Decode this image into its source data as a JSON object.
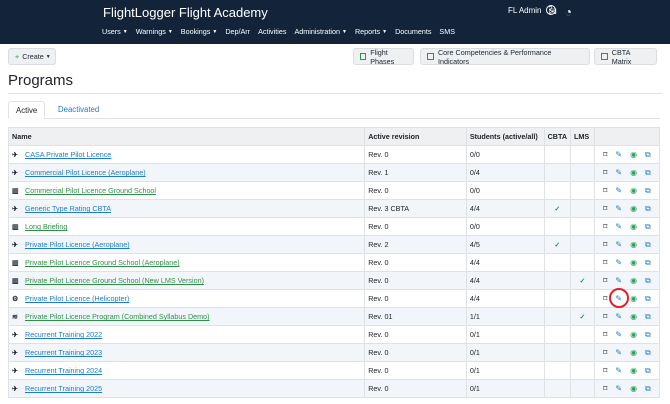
{
  "app": {
    "title": "FlightLogger Flight Academy",
    "user": "FL Admin",
    "help": "?"
  },
  "nav": [
    "Users",
    "Warnings",
    "Bookings",
    "Dep/Arr",
    "Activities",
    "Administration",
    "Reports",
    "Documents",
    "SMS"
  ],
  "toolbar": {
    "create": "Create",
    "flight_phases": "Flight Phases",
    "core": "Core Competencies & Performance Indicators",
    "cbta": "CBTA Matrix"
  },
  "page": {
    "title": "Programs",
    "tab_active": "Active",
    "tab_deactivated": "Deactivated"
  },
  "table": {
    "headers": [
      "Name",
      "Active revision",
      "Students (active/all)",
      "CBTA",
      "LMS"
    ],
    "rows": [
      {
        "name": "CASA Private Pilot Licence",
        "revision": "Rev. 0",
        "students": "0/0",
        "cbta": "",
        "lms": "",
        "icon": "plane",
        "green": false
      },
      {
        "name": "Commercial Pilot Licence (Aeroplane)",
        "revision": "Rev. 1",
        "students": "0/4",
        "cbta": "",
        "lms": "",
        "icon": "plane",
        "green": false
      },
      {
        "name": "Commercial Pilot Licence Ground School",
        "revision": "Rev. 0",
        "students": "0/0",
        "cbta": "",
        "lms": "",
        "icon": "desk",
        "green": true
      },
      {
        "name": "Generic Type Rating CBTA",
        "revision": "Rev. 3 CBTA",
        "students": "4/4",
        "cbta": "✓",
        "lms": "",
        "icon": "plane",
        "green": false
      },
      {
        "name": "Long Briefing",
        "revision": "Rev. 0",
        "students": "0/0",
        "cbta": "",
        "lms": "",
        "icon": "desk",
        "green": true
      },
      {
        "name": "Private Pilot Licence (Aeroplane)",
        "revision": "Rev. 2",
        "students": "4/5",
        "cbta": "✓",
        "lms": "",
        "icon": "plane",
        "green": false
      },
      {
        "name": "Private Pilot Licence Ground School (Aeroplane)",
        "revision": "Rev. 0",
        "students": "4/4",
        "cbta": "",
        "lms": "",
        "icon": "desk",
        "green": true
      },
      {
        "name": "Private Pilot Licence Ground School (New LMS Version)",
        "revision": "Rev. 0",
        "students": "4/4",
        "cbta": "",
        "lms": "✓",
        "icon": "desk",
        "green": true
      },
      {
        "name": "Private Pilot Licence (Helicopter)",
        "revision": "Rev. 0",
        "students": "4/4",
        "cbta": "",
        "lms": "",
        "icon": "heli",
        "green": false
      },
      {
        "name": "Private Pilot Licence Program (Combined Syllabus Demo)",
        "revision": "Rev. 01",
        "students": "1/1",
        "cbta": "",
        "lms": "✓",
        "icon": "stack",
        "green": true
      },
      {
        "name": "Recurrent Training 2022",
        "revision": "Rev. 0",
        "students": "0/1",
        "cbta": "",
        "lms": "",
        "icon": "plane",
        "green": false
      },
      {
        "name": "Recurrent Training 2023",
        "revision": "Rev. 0",
        "students": "0/1",
        "cbta": "",
        "lms": "",
        "icon": "plane",
        "green": false
      },
      {
        "name": "Recurrent Training 2024",
        "revision": "Rev. 0",
        "students": "0/1",
        "cbta": "",
        "lms": "",
        "icon": "plane",
        "green": false
      },
      {
        "name": "Recurrent Training 2025",
        "revision": "Rev. 0",
        "students": "0/1",
        "cbta": "",
        "lms": "",
        "icon": "plane",
        "green": false
      }
    ]
  }
}
